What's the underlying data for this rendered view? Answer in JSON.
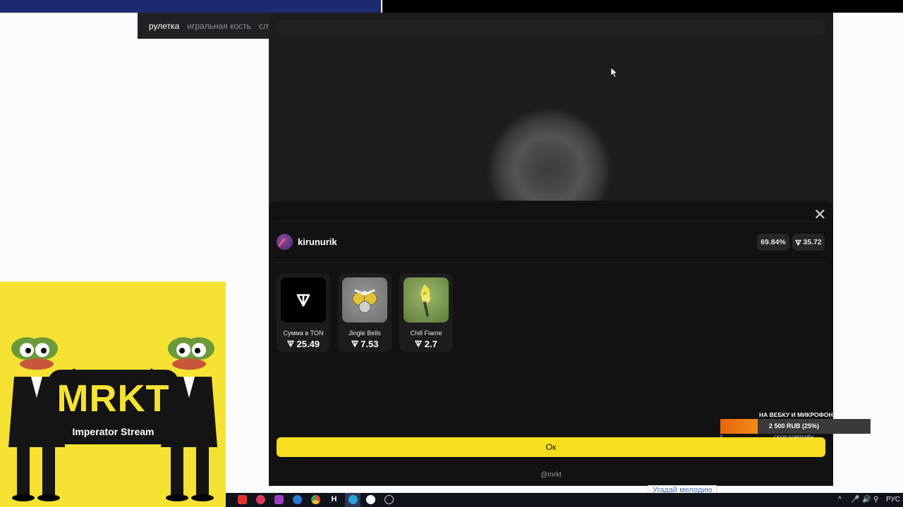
{
  "browser": {
    "tabs": [
      {
        "label": "рулетка",
        "active": true
      },
      {
        "label": "игральная кость",
        "active": false
      },
      {
        "label": "случ",
        "active": false
      }
    ]
  },
  "modal": {
    "user": {
      "name": "kirunurik",
      "avatar_icon": "rocket-avatar-icon"
    },
    "stats": {
      "percent": "69.84%",
      "ton": "35.72"
    },
    "items": [
      {
        "label": "Сумма в TON",
        "price": "25.49",
        "icon": "ton-logo-icon"
      },
      {
        "label": "Jingle Bells",
        "price": "7.53",
        "icon": "jingle-bells-icon"
      },
      {
        "label": "Chill Flame",
        "price": "2.7",
        "icon": "chill-flame-icon"
      }
    ],
    "ok_label": "Ок",
    "footer": "@mrkt",
    "close_icon": "close-icon"
  },
  "donation": {
    "title": "НА ВЕБКУ И МИКРОФОН",
    "progress_text": "2 500 RUB (25%)",
    "progress_fraction": 0.25,
    "min": "0",
    "status": "СБОР ЗАВЕРШЁН"
  },
  "link": {
    "text": "Угадай мелодию"
  },
  "stream_logo": {
    "title": "MRKT",
    "subtitle": "Imperator Stream"
  },
  "taskbar": {
    "language": "РУС"
  },
  "colors": {
    "accent": "#f7de20",
    "sheet": "#121212",
    "donation_fill": "#ee7a0e",
    "logo_bg": "#f5e233"
  }
}
